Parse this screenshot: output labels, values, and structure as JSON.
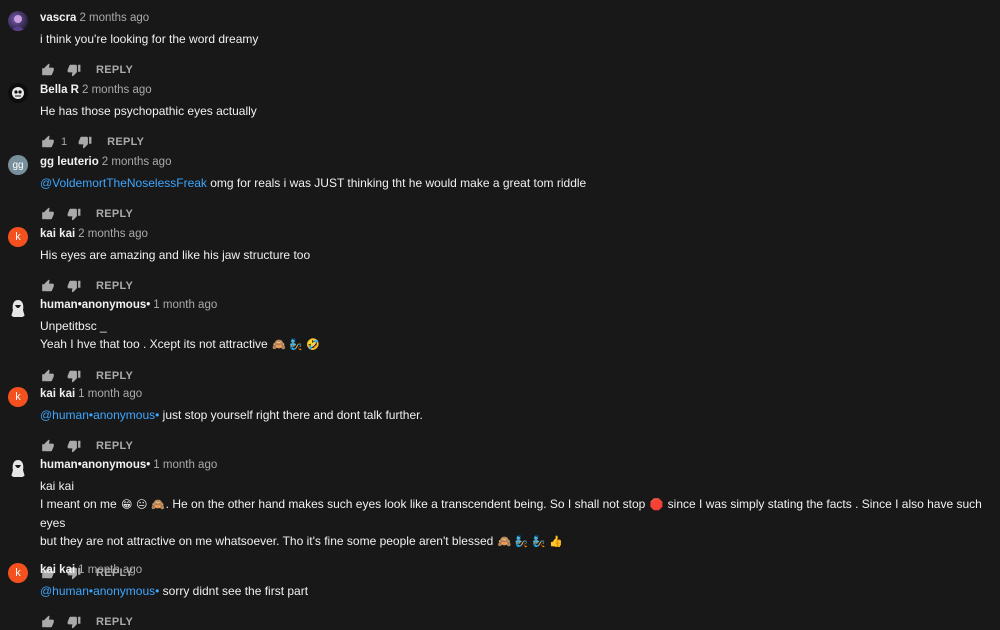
{
  "comments": [
    {
      "author": "vascra",
      "time": "2 months ago",
      "avatar": "photo",
      "lines": [
        [
          {
            "t": "i think you're looking for the word dreamy"
          }
        ]
      ],
      "likes": "",
      "reply_label": "REPLY"
    },
    {
      "author": "Bella R",
      "time": "2 months ago",
      "avatar": "photo",
      "lines": [
        [
          {
            "t": "He has those psychopathic eyes actually"
          }
        ]
      ],
      "likes": "1",
      "reply_label": "REPLY"
    },
    {
      "author": "gg leuterio",
      "time": "2 months ago",
      "avatar": "gg",
      "lines": [
        [
          {
            "t": "@VoldemortTheNoselessFreak",
            "m": true
          },
          {
            "t": " omg for reals i was JUST thinking tht he would make a great tom riddle"
          }
        ]
      ],
      "likes": "",
      "reply_label": "REPLY"
    },
    {
      "author": "kai kai",
      "time": "2 months ago",
      "avatar": "k",
      "lines": [
        [
          {
            "t": "His eyes are amazing and like his jaw structure too"
          }
        ]
      ],
      "likes": "",
      "reply_label": "REPLY"
    },
    {
      "author": "human•anonymous•",
      "time": "1 month ago",
      "avatar": "photo",
      "lines": [
        [
          {
            "t": "Unpetitbsc _"
          }
        ],
        [
          {
            "t": "Yeah I hve that too . Xcept its not attractive "
          },
          {
            "t": "🙈 🧞 🤣",
            "e": true
          }
        ]
      ],
      "likes": "",
      "reply_label": "REPLY"
    },
    {
      "author": "kai kai",
      "time": "1 month ago",
      "avatar": "k",
      "lines": [
        [
          {
            "t": "@human•anonymous•",
            "m": true
          },
          {
            "t": " just stop yourself right there and dont talk further."
          }
        ]
      ],
      "likes": "",
      "reply_label": "REPLY"
    },
    {
      "author": "human•anonymous•",
      "time": "1 month ago",
      "avatar": "photo",
      "lines": [
        [
          {
            "t": "kai kai"
          }
        ],
        [
          {
            "t": "I meant on me "
          },
          {
            "t": "😁 😐 🙈",
            "e": true
          },
          {
            "t": ". He on the other hand makes such eyes look like a transcendent being. So I shall not stop "
          },
          {
            "t": "🛑",
            "e": true
          },
          {
            "t": " since I was simply stating the facts . Since I also have such eyes"
          }
        ],
        [
          {
            "t": "but they are not attractive on me whatsoever. Tho it's fine some people aren't blessed "
          },
          {
            "t": "🙈 🧞 🧞 👍",
            "e": true
          }
        ]
      ],
      "likes": "",
      "reply_label": "REPLY"
    },
    {
      "author": "kai kai",
      "time": "1 month ago",
      "avatar": "k",
      "lines": [
        [
          {
            "t": "@human•anonymous•",
            "m": true
          },
          {
            "t": " sorry didnt see the first part"
          }
        ]
      ],
      "likes": "",
      "reply_label": "REPLY"
    }
  ],
  "icons": {
    "like": "thumbs-up-icon",
    "dislike": "thumbs-down-icon"
  },
  "colors": {
    "background": "#181818",
    "text": "#f1f1f1",
    "secondary_text": "#aaaaaa",
    "mention": "#3ea6ff",
    "avatar_k": "#f4511e",
    "avatar_gg": "#78909c"
  }
}
